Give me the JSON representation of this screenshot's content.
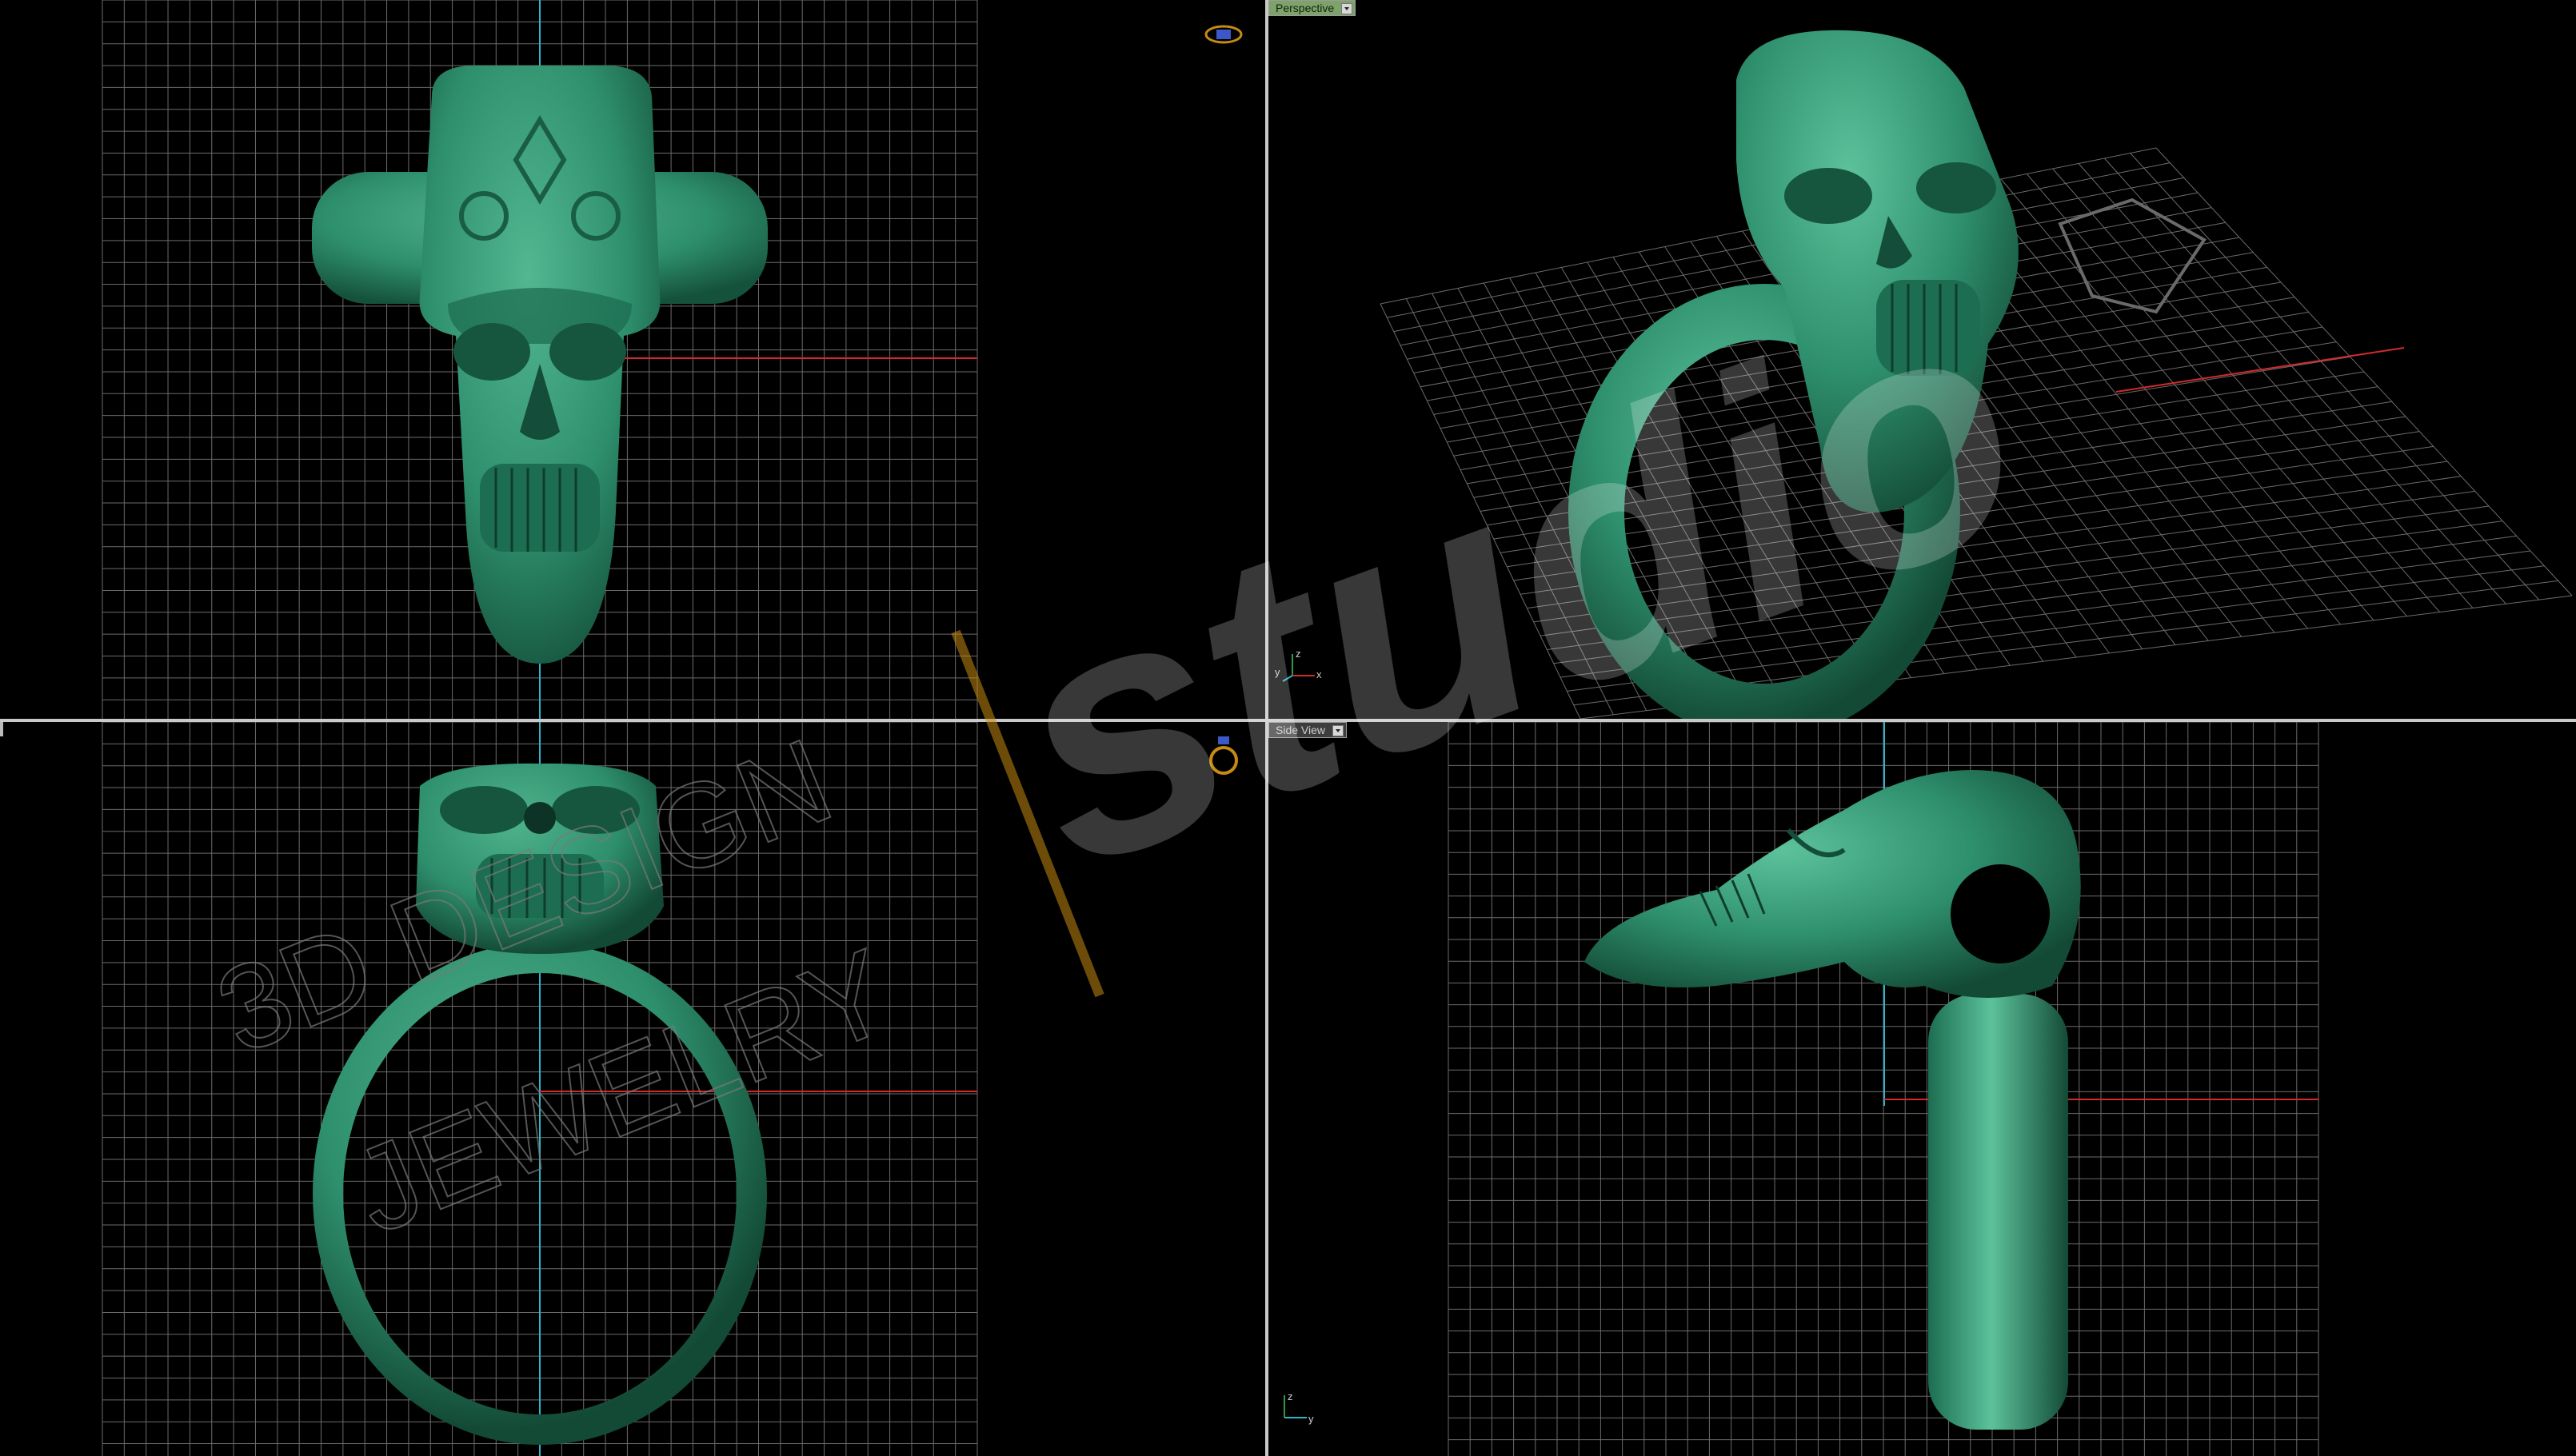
{
  "viewports": {
    "top": {
      "name": ""
    },
    "perspective": {
      "label": "Perspective"
    },
    "front": {
      "name": ""
    },
    "side": {
      "label": "Side View"
    }
  },
  "axis_tripods": {
    "perspective": {
      "labels": [
        "z",
        "y",
        "x"
      ]
    },
    "side": {
      "labels": [
        "z",
        "y"
      ]
    }
  },
  "watermark": {
    "brand": "studio",
    "line1": "3D DESIGN",
    "line2": "JEWELRY"
  },
  "colors": {
    "model_green": "#2e8f6d",
    "grid": "#6b6b6b",
    "axis_x": "#d22b2b",
    "axis_y": "#2fb4c8",
    "label_persp": "#7ea36a",
    "accent_gold": "#c68b12"
  },
  "icons": {
    "view_ring_top": "ring-top-icon",
    "view_ring_front": "ring-front-icon"
  }
}
